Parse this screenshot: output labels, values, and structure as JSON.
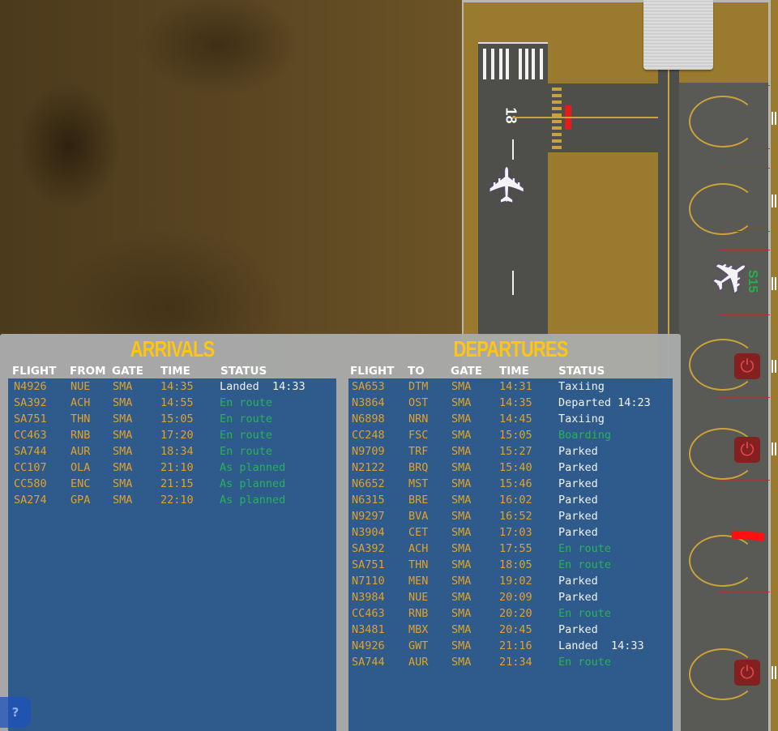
{
  "arrivals": {
    "title": "ARRIVALS",
    "columns": [
      "FLIGHT",
      "FROM",
      "GATE",
      "TIME",
      "STATUS"
    ],
    "rows": [
      {
        "flight": "N4926",
        "from": "NUE",
        "gate": "SMA",
        "time": "14:35",
        "status": "Landed  14:33",
        "status_color": "white"
      },
      {
        "flight": "SA392",
        "from": "ACH",
        "gate": "SMA",
        "time": "14:55",
        "status": "En route",
        "status_color": "green"
      },
      {
        "flight": "SA751",
        "from": "THN",
        "gate": "SMA",
        "time": "15:05",
        "status": "En route",
        "status_color": "green"
      },
      {
        "flight": "CC463",
        "from": "RNB",
        "gate": "SMA",
        "time": "17:20",
        "status": "En route",
        "status_color": "green"
      },
      {
        "flight": "SA744",
        "from": "AUR",
        "gate": "SMA",
        "time": "18:34",
        "status": "En route",
        "status_color": "green"
      },
      {
        "flight": "CC107",
        "from": "OLA",
        "gate": "SMA",
        "time": "21:10",
        "status": "As planned",
        "status_color": "green"
      },
      {
        "flight": "CC580",
        "from": "ENC",
        "gate": "SMA",
        "time": "21:15",
        "status": "As planned",
        "status_color": "green"
      },
      {
        "flight": "SA274",
        "from": "GPA",
        "gate": "SMA",
        "time": "22:10",
        "status": "As planned",
        "status_color": "green"
      }
    ]
  },
  "departures": {
    "title": "DEPARTURES",
    "columns": [
      "FLIGHT",
      "TO",
      "GATE",
      "TIME",
      "STATUS"
    ],
    "rows": [
      {
        "flight": "SA653",
        "to": "DTM",
        "gate": "SMA",
        "time": "14:31",
        "status": "Taxiing",
        "status_color": "white"
      },
      {
        "flight": "N3864",
        "to": "OST",
        "gate": "SMA",
        "time": "14:35",
        "status": "Departed 14:23",
        "status_color": "white"
      },
      {
        "flight": "N6898",
        "to": "NRN",
        "gate": "SMA",
        "time": "14:45",
        "status": "Taxiing",
        "status_color": "white"
      },
      {
        "flight": "CC248",
        "to": "FSC",
        "gate": "SMA",
        "time": "15:05",
        "status": "Boarding",
        "status_color": "green"
      },
      {
        "flight": "N9709",
        "to": "TRF",
        "gate": "SMA",
        "time": "15:27",
        "status": "Parked",
        "status_color": "white"
      },
      {
        "flight": "N2122",
        "to": "BRQ",
        "gate": "SMA",
        "time": "15:40",
        "status": "Parked",
        "status_color": "white"
      },
      {
        "flight": "N6652",
        "to": "MST",
        "gate": "SMA",
        "time": "15:46",
        "status": "Parked",
        "status_color": "white"
      },
      {
        "flight": "N6315",
        "to": "BRE",
        "gate": "SMA",
        "time": "16:02",
        "status": "Parked",
        "status_color": "white"
      },
      {
        "flight": "N9297",
        "to": "BVA",
        "gate": "SMA",
        "time": "16:52",
        "status": "Parked",
        "status_color": "white"
      },
      {
        "flight": "N3904",
        "to": "CET",
        "gate": "SMA",
        "time": "17:03",
        "status": "Parked",
        "status_color": "white"
      },
      {
        "flight": "SA392",
        "to": "ACH",
        "gate": "SMA",
        "time": "17:55",
        "status": "En route",
        "status_color": "green"
      },
      {
        "flight": "SA751",
        "to": "THN",
        "gate": "SMA",
        "time": "18:05",
        "status": "En route",
        "status_color": "green"
      },
      {
        "flight": "N7110",
        "to": "MEN",
        "gate": "SMA",
        "time": "19:02",
        "status": "Parked",
        "status_color": "white"
      },
      {
        "flight": "N3984",
        "to": "NUE",
        "gate": "SMA",
        "time": "20:09",
        "status": "Parked",
        "status_color": "white"
      },
      {
        "flight": "CC463",
        "to": "RNB",
        "gate": "SMA",
        "time": "20:20",
        "status": "En route",
        "status_color": "green"
      },
      {
        "flight": "N3481",
        "to": "MBX",
        "gate": "SMA",
        "time": "20:45",
        "status": "Parked",
        "status_color": "white"
      },
      {
        "flight": "N4926",
        "to": "GWT",
        "gate": "SMA",
        "time": "21:16",
        "status": "Landed  14:33",
        "status_color": "white"
      },
      {
        "flight": "SA744",
        "to": "AUR",
        "gate": "SMA",
        "time": "21:34",
        "status": "En route",
        "status_color": "green"
      }
    ]
  },
  "map": {
    "runway_number": "18",
    "gate_label": "S15",
    "icons": {
      "airplane": "✈",
      "power": "⏻",
      "help": "?"
    }
  },
  "help_button": {
    "label": "?"
  }
}
